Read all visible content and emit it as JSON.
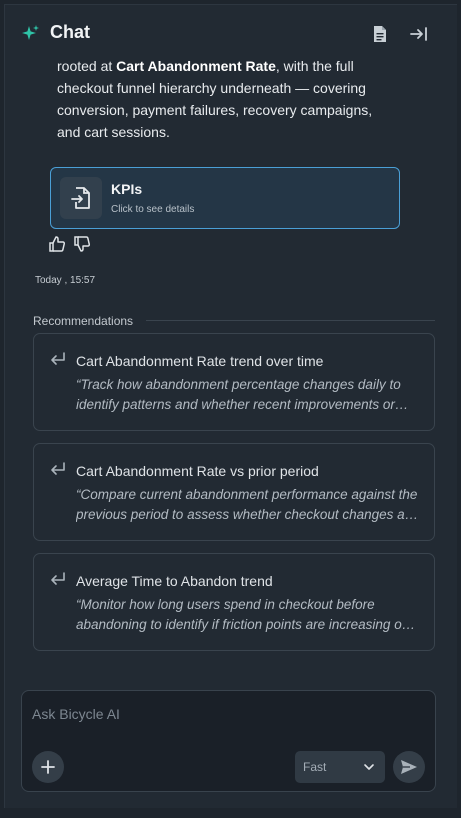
{
  "header": {
    "title": "Chat",
    "logo_icon": "sparkle-icon",
    "accent_color": "#2fc4a8",
    "actions": [
      {
        "icon": "document-icon"
      },
      {
        "icon": "collapse-panel-icon"
      }
    ]
  },
  "message": {
    "line_1_prefix": "rooted at ",
    "line_1_bold": "Cart Abandonment Rate",
    "line_1_suffix": ", with the full",
    "rest": "checkout funnel hierarchy underneath — covering conversion, payment failures, recovery campaigns, and cart sessions."
  },
  "kpi_card": {
    "title": "KPIs",
    "subtitle": "Click to see details",
    "icon": "file-import-icon",
    "border_color": "#4a9fd6"
  },
  "feedback": {
    "up_icon": "thumbs-up-icon",
    "down_icon": "thumbs-down-icon"
  },
  "timestamp": "Today , 15:57",
  "recommendations": {
    "header": "Recommendations",
    "items": [
      {
        "title": "Cart Abandonment Rate trend over time",
        "description": "“Track how abandonment percentage changes daily to identify patterns and whether recent improvements or regressions are persisting.”"
      },
      {
        "title": "Cart Abandonment Rate vs prior period",
        "description": "“Compare current abandonment performance against the previous period to assess whether checkout changes are working.”"
      },
      {
        "title": "Average Time to Abandon trend",
        "description": "“Monitor how long users spend in checkout before abandoning to identify if friction points are increasing over time.”"
      }
    ]
  },
  "composer": {
    "placeholder": "Ask Bicycle AI",
    "model": "Fast",
    "add_icon": "plus-icon",
    "send_icon": "send-icon"
  }
}
